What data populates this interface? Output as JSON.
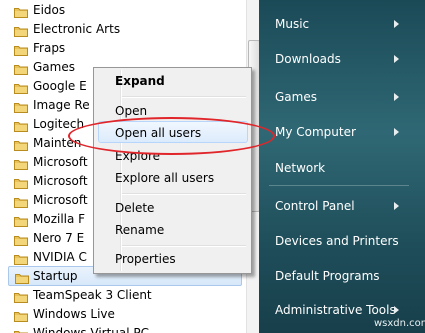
{
  "programs": [
    {
      "label": "Eidos"
    },
    {
      "label": "Electronic Arts"
    },
    {
      "label": "Fraps"
    },
    {
      "label": "Games"
    },
    {
      "label": "Google E"
    },
    {
      "label": "Image Re"
    },
    {
      "label": "Logitech"
    },
    {
      "label": "Mainten"
    },
    {
      "label": "Microsoft"
    },
    {
      "label": "Microsoft"
    },
    {
      "label": "Microsoft"
    },
    {
      "label": "Mozilla F"
    },
    {
      "label": "Nero 7 E"
    },
    {
      "label": "NVIDIA C"
    },
    {
      "label": "Startup"
    },
    {
      "label": "TeamSpeak 3 Client"
    },
    {
      "label": "Windows Live"
    },
    {
      "label": "Windows Virtual PC"
    }
  ],
  "context_menu": {
    "expand": "Expand",
    "open": "Open",
    "open_all_users": "Open all users",
    "explore": "Explore",
    "explore_all_users": "Explore all users",
    "delete": "Delete",
    "rename": "Rename",
    "properties": "Properties"
  },
  "right_pane": {
    "music": "Music",
    "downloads": "Downloads",
    "games": "Games",
    "my_computer": "My Computer",
    "network": "Network",
    "control_panel": "Control Panel",
    "devices_printers": "Devices and Printers",
    "default_programs": "Default Programs",
    "admin_tools": "Administrative Tools"
  },
  "watermark": "wsxdn.com",
  "colors": {
    "annotation": "#e0262b",
    "right_pane": "#2f6874",
    "highlight": "#dcebfc",
    "folder": "#e8c25a"
  },
  "icons": {
    "program_item": "folder-icon",
    "submenu": "chevron-right-icon"
  }
}
